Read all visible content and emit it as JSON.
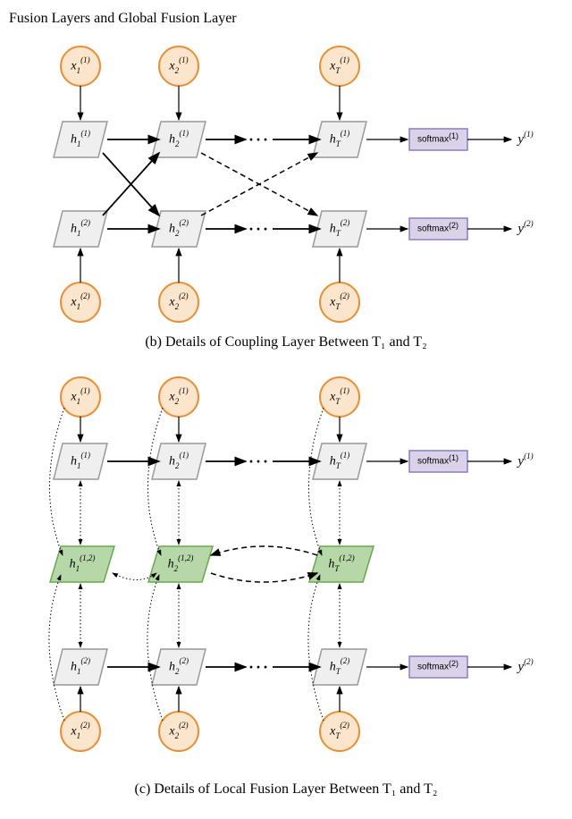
{
  "header": "Fusion Layers and Global Fusion Layer",
  "diagram_b": {
    "caption": "(b) Details of Coupling Layer Between T₁ and T₂",
    "inputs_top": [
      {
        "base": "x",
        "sub": "1",
        "sup": "(1)"
      },
      {
        "base": "x",
        "sub": "2",
        "sup": "(1)"
      },
      {
        "base": "x",
        "sub": "T",
        "sup": "(1)"
      }
    ],
    "inputs_bottom": [
      {
        "base": "x",
        "sub": "1",
        "sup": "(2)"
      },
      {
        "base": "x",
        "sub": "2",
        "sup": "(2)"
      },
      {
        "base": "x",
        "sub": "T",
        "sup": "(2)"
      }
    ],
    "hidden_top": [
      {
        "base": "h",
        "sub": "1",
        "sup": "(1)"
      },
      {
        "base": "h",
        "sub": "2",
        "sup": "(1)"
      },
      {
        "base": "h",
        "sub": "T",
        "sup": "(1)"
      }
    ],
    "hidden_bottom": [
      {
        "base": "h",
        "sub": "1",
        "sup": "(2)"
      },
      {
        "base": "h",
        "sub": "2",
        "sup": "(2)"
      },
      {
        "base": "h",
        "sub": "T",
        "sup": "(2)"
      }
    ],
    "softmax_top": "softmax",
    "softmax_top_sup": "(1)",
    "softmax_bottom": "softmax",
    "softmax_bottom_sup": "(2)",
    "output_top": {
      "base": "y",
      "sup": "(1)"
    },
    "output_bottom": {
      "base": "y",
      "sup": "(2)"
    }
  },
  "diagram_c": {
    "caption": "(c) Details of Local Fusion Layer Between T₁ and T₂",
    "inputs_top": [
      {
        "base": "x",
        "sub": "1",
        "sup": "(1)"
      },
      {
        "base": "x",
        "sub": "2",
        "sup": "(1)"
      },
      {
        "base": "x",
        "sub": "T",
        "sup": "(1)"
      }
    ],
    "inputs_bottom": [
      {
        "base": "x",
        "sub": "1",
        "sup": "(2)"
      },
      {
        "base": "x",
        "sub": "2",
        "sup": "(2)"
      },
      {
        "base": "x",
        "sub": "T",
        "sup": "(2)"
      }
    ],
    "hidden_top": [
      {
        "base": "h",
        "sub": "1",
        "sup": "(1)"
      },
      {
        "base": "h",
        "sub": "2",
        "sup": "(1)"
      },
      {
        "base": "h",
        "sub": "T",
        "sup": "(1)"
      }
    ],
    "hidden_bottom": [
      {
        "base": "h",
        "sub": "1",
        "sup": "(2)"
      },
      {
        "base": "h",
        "sub": "2",
        "sup": "(2)"
      },
      {
        "base": "h",
        "sub": "T",
        "sup": "(2)"
      }
    ],
    "fusion": [
      {
        "base": "h",
        "sub": "1",
        "sup": "(1,2)"
      },
      {
        "base": "h",
        "sub": "2",
        "sup": "(1,2)"
      },
      {
        "base": "h",
        "sub": "T",
        "sup": "(1,2)"
      }
    ],
    "softmax_top": "softmax",
    "softmax_top_sup": "(1)",
    "softmax_bottom": "softmax",
    "softmax_bottom_sup": "(2)",
    "output_top": {
      "base": "y",
      "sup": "(1)"
    },
    "output_bottom": {
      "base": "y",
      "sup": "(2)"
    }
  }
}
